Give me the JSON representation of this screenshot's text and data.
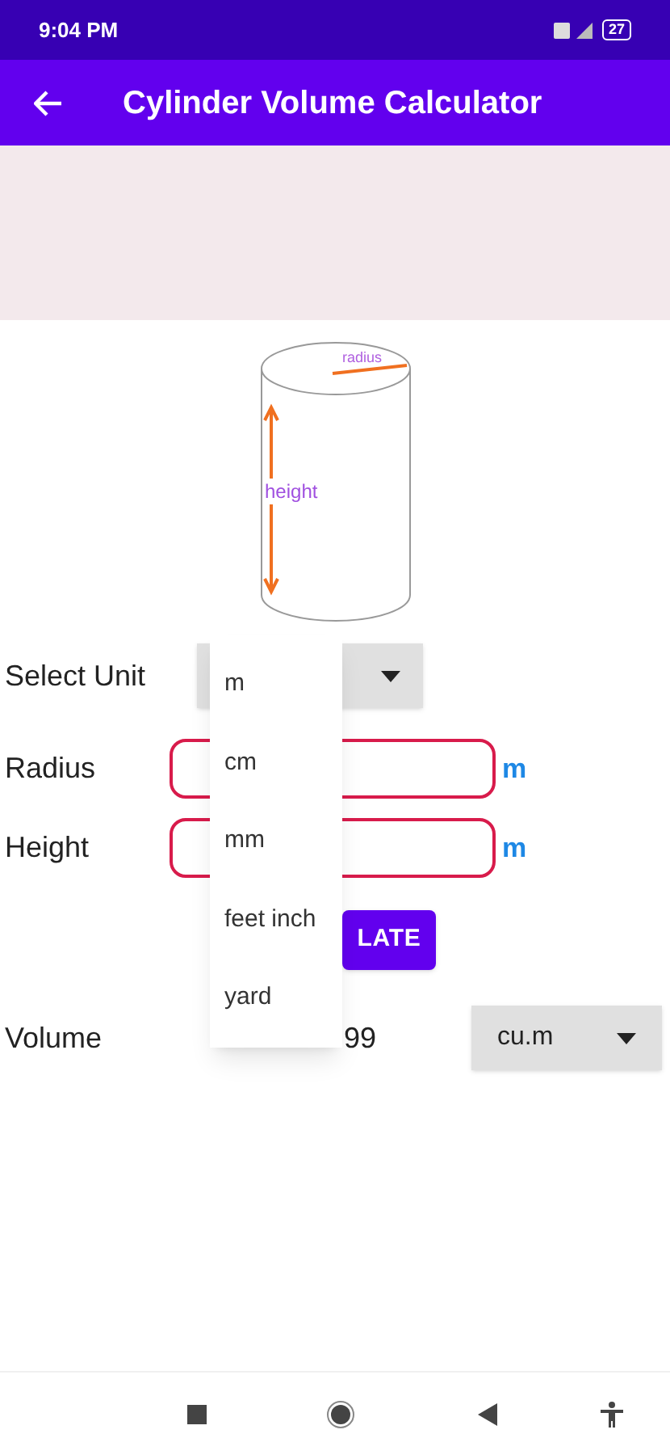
{
  "status_bar": {
    "time": "9:04 PM",
    "battery": "27"
  },
  "app_bar": {
    "title": "Cylinder Volume Calculator"
  },
  "diagram": {
    "radius_label": "radius",
    "height_label": "height"
  },
  "form": {
    "unit_label": "Select Unit",
    "radius_label": "Radius",
    "radius_unit": "m",
    "height_label": "Height",
    "height_unit": "m",
    "calculate_button": "LATE",
    "volume_label": "Volume",
    "volume_value": "99",
    "volume_unit": "cu.m"
  },
  "unit_menu": {
    "items": [
      "m",
      "cm",
      "mm",
      "feet inch",
      "yard"
    ]
  }
}
